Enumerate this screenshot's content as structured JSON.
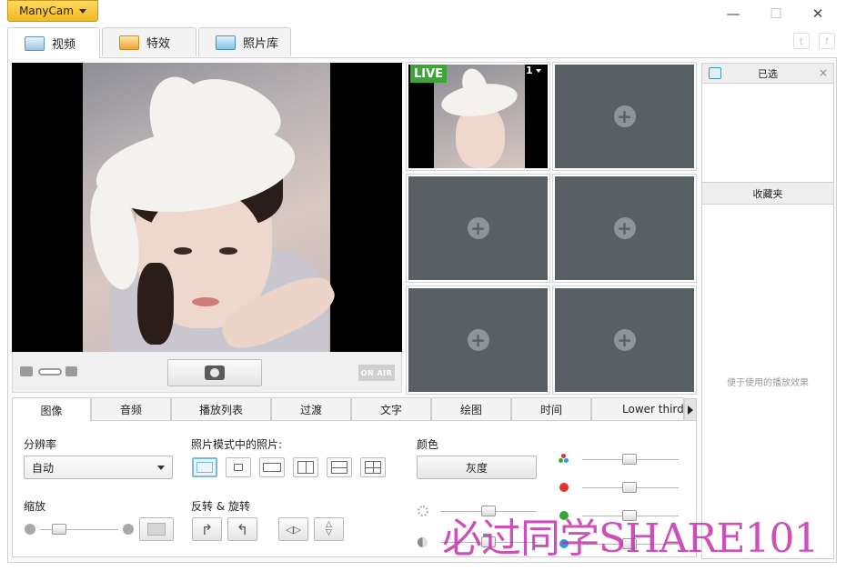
{
  "app": {
    "menu_label": "ManyCam"
  },
  "window_controls": {
    "minimize": "—",
    "maximize": "☐",
    "close": "✕"
  },
  "main_tabs": [
    {
      "label": "视频",
      "icon": "webcam-icon"
    },
    {
      "label": "特效",
      "icon": "effects-image-icon"
    },
    {
      "label": "照片库",
      "icon": "gallery-icon"
    }
  ],
  "social": {
    "twitter": "t",
    "facebook": "f"
  },
  "preview": {
    "on_air_label": "ON AIR"
  },
  "live_grid": {
    "live_badge": "LIVE",
    "active_slot_number": "1",
    "empty_slot_icon": "+"
  },
  "side_panel": {
    "title": "已选",
    "close": "×",
    "favorites_title": "收藏夹",
    "favorites_empty_hint": "便于使用的播放效果"
  },
  "sub_tabs": [
    "图像",
    "音频",
    "播放列表",
    "过渡",
    "文字",
    "绘图",
    "时间",
    "Lower third"
  ],
  "image_panel": {
    "resolution_label": "分辨率",
    "resolution_value": "自动",
    "photo_mode_label": "照片模式中的照片:",
    "zoom_label": "缩放",
    "flip_rotate_label": "反转 & 旋转",
    "color_label": "颜色",
    "grayscale_button": "灰度"
  },
  "colors": {
    "accent": "#f3b91e",
    "live_green": "#3ea43a",
    "slot_bg": "#596063",
    "selected_outline": "#79b8e0"
  },
  "watermark": "必过同学SHARE101"
}
